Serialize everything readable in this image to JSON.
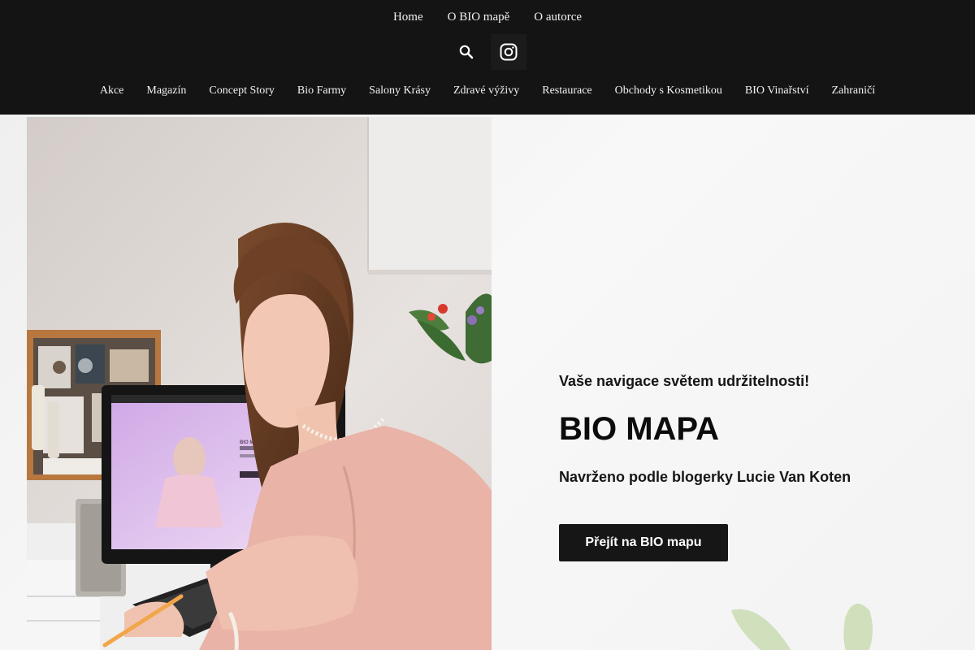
{
  "header": {
    "top_nav": [
      "Home",
      "O BIO mapě",
      "O autorce"
    ],
    "icons": [
      "search-icon",
      "instagram-icon"
    ],
    "categories": [
      "Akce",
      "Magazín",
      "Concept Story",
      "Bio Farmy",
      "Salony Krásy",
      "Zdravé výživy",
      "Restaurace",
      "Obchody s Kosmetikou",
      "BIO Vinařství",
      "Zahraničí"
    ]
  },
  "hero": {
    "tagline": "Vaše navigace světem udržitelnosti!",
    "title": "BIO MAPA",
    "subtitle": "Navrženo podle blogerky Lucie Van Koten",
    "cta_label": "Přejít na BIO mapu",
    "screen_text": "BIO MAPA"
  },
  "colors": {
    "header_bg": "#141414",
    "nav_text": "#f2f2f2",
    "button_bg": "#161616",
    "blouse": "#e9b3a7",
    "screen": "#d9b7ea"
  }
}
